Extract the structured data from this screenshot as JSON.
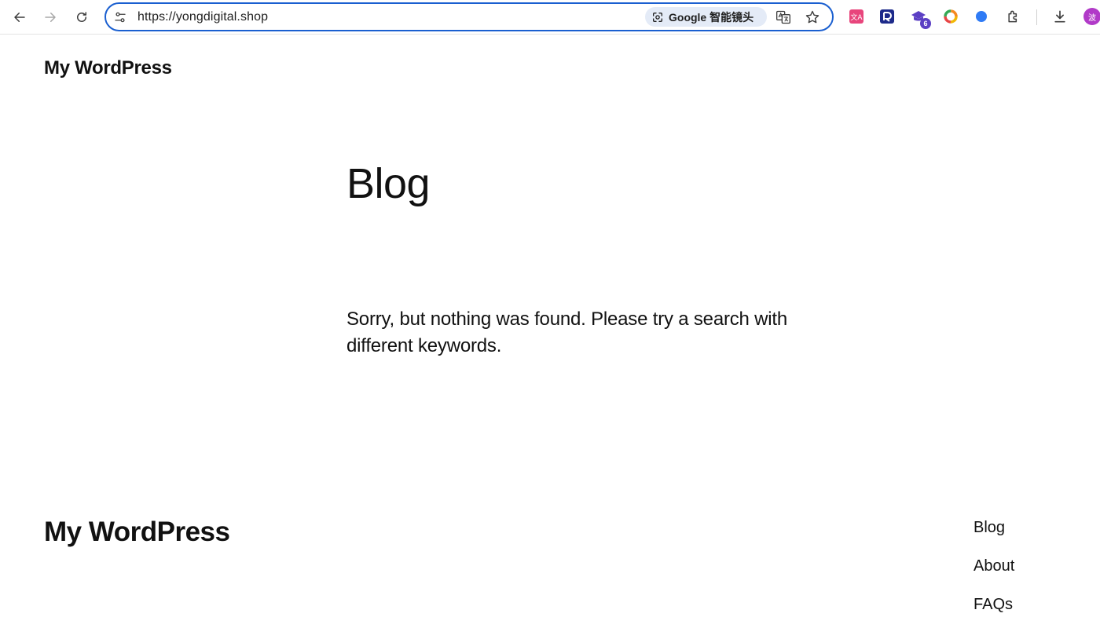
{
  "browser": {
    "url": "https://yongdigital.shop",
    "lens_label": "Google 智能镜头",
    "extension_badge": "6",
    "avatar_letter": "波",
    "accent_color": "#1a5fd0"
  },
  "header": {
    "site_title": "My WordPress"
  },
  "main": {
    "heading": "Blog",
    "message": "Sorry, but nothing was found. Please try a search with different keywords."
  },
  "footer": {
    "site_title": "My WordPress",
    "nav": [
      {
        "label": "Blog"
      },
      {
        "label": "About"
      },
      {
        "label": "FAQs"
      }
    ]
  }
}
